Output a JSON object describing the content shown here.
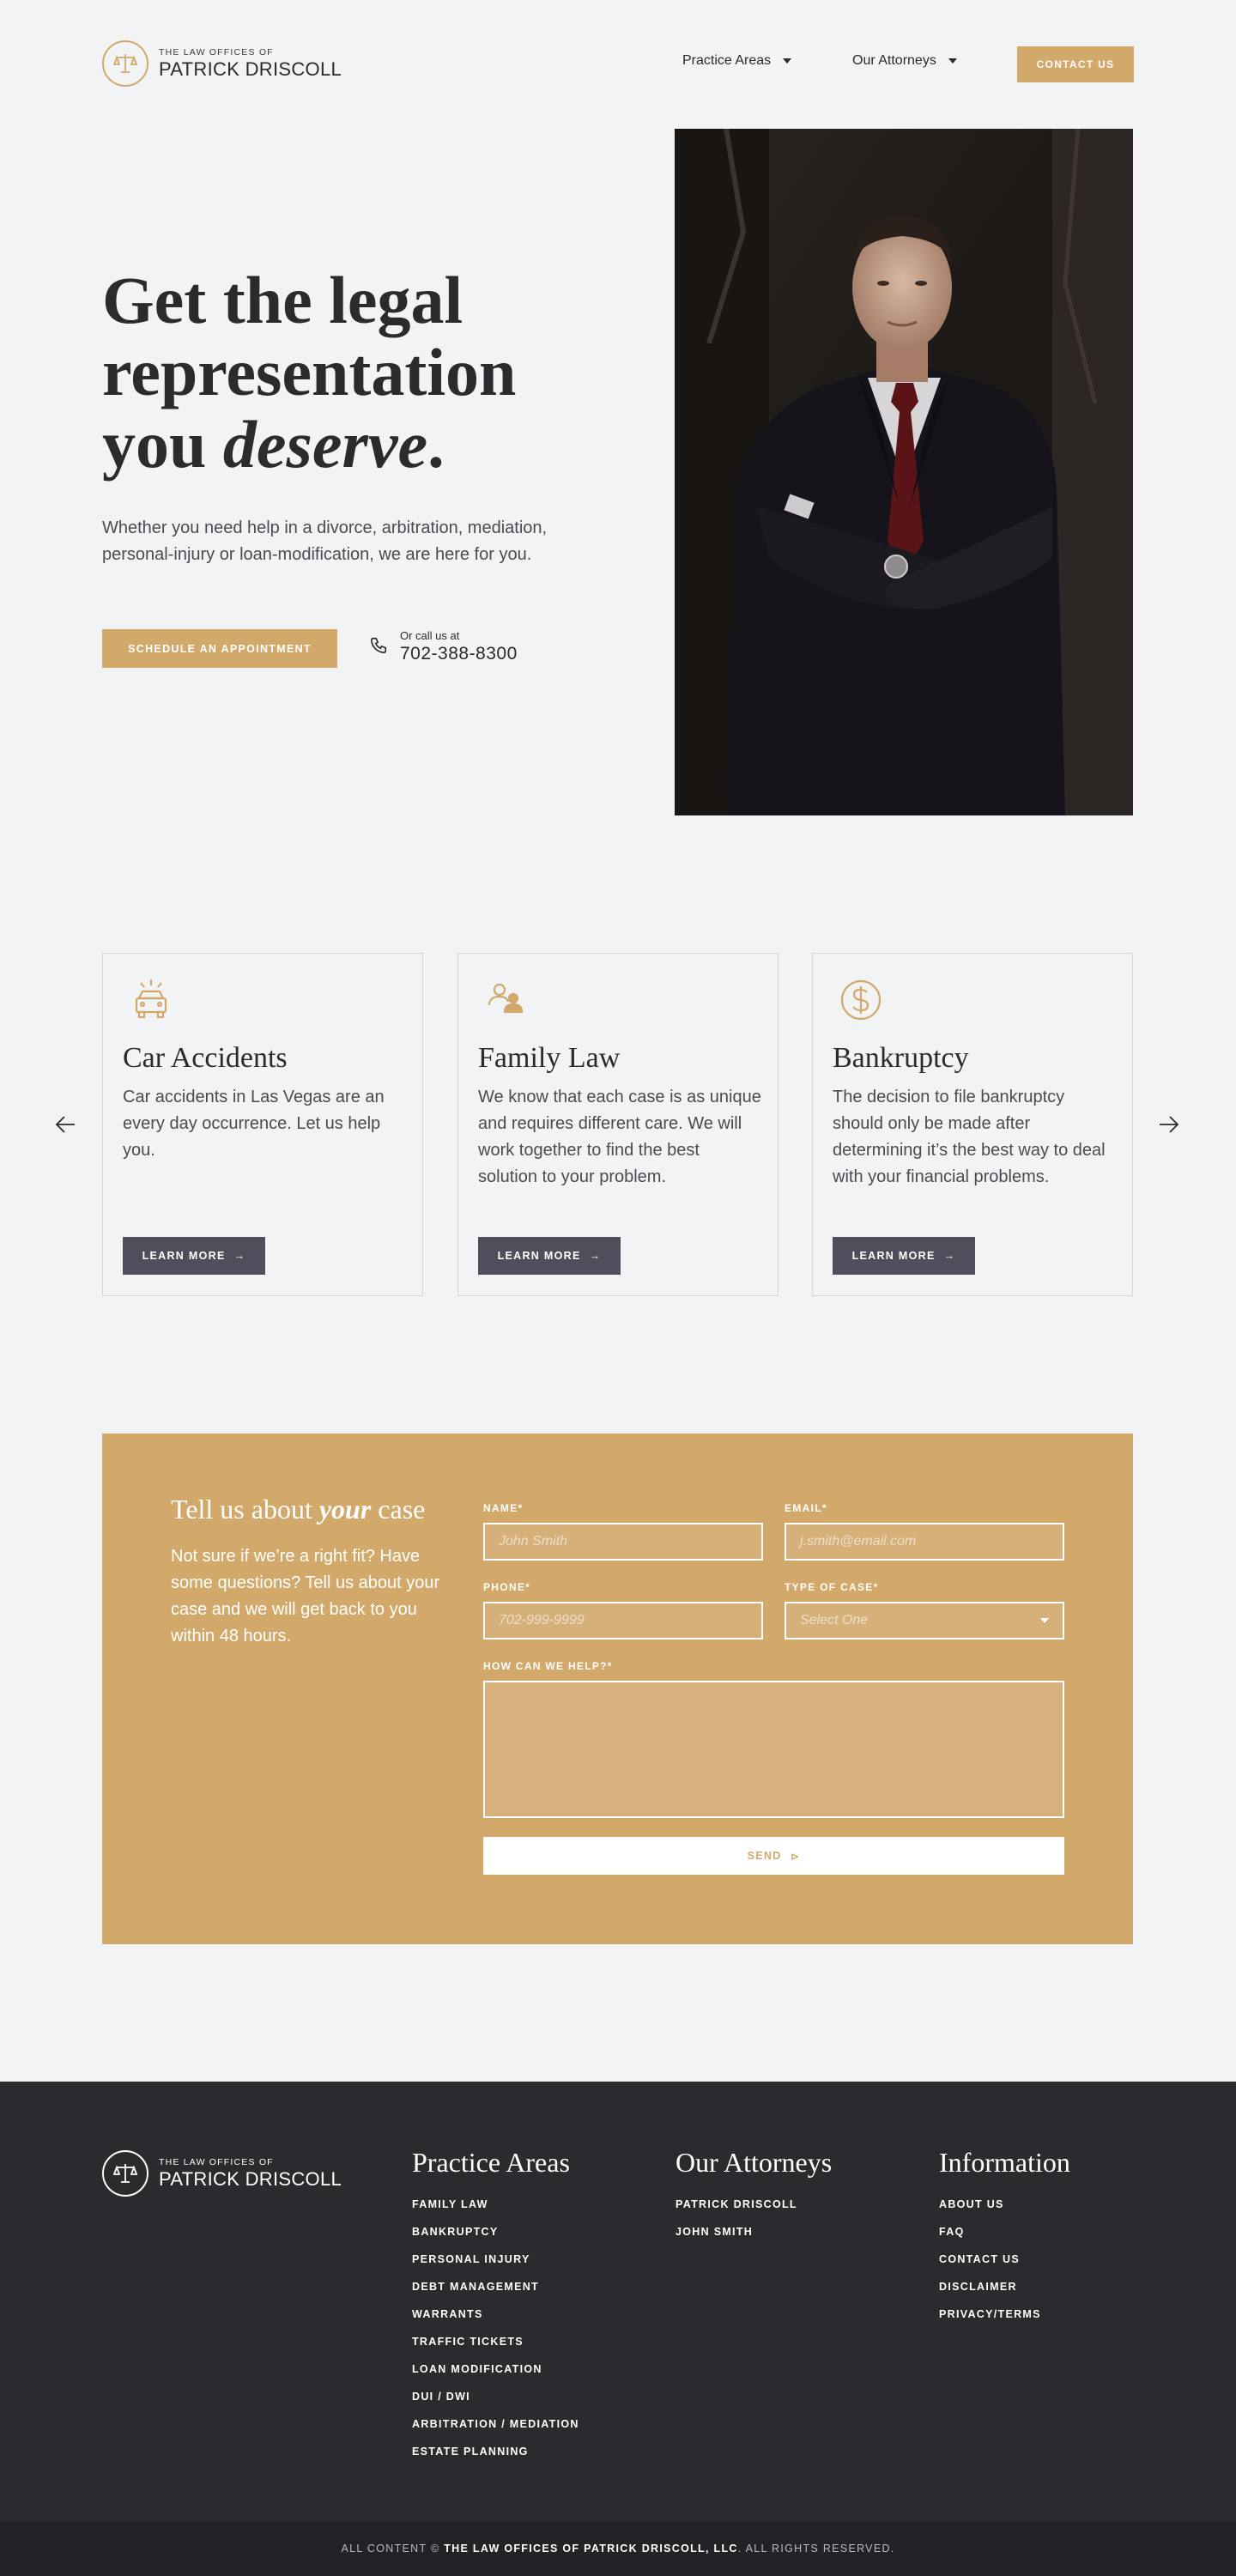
{
  "brand": {
    "small": "THE LAW OFFICES OF",
    "name": "PATRICK DRISCOLL"
  },
  "nav": {
    "practice": "Practice Areas",
    "attorneys": "Our Attorneys",
    "contact": "CONTACT US"
  },
  "hero": {
    "title_line1": "Get the legal",
    "title_line2": "representation",
    "title_line3_a": "you ",
    "title_line3_b": "deserve",
    "title_line3_c": ".",
    "lede": "Whether you need help in a divorce, arbitration, mediation, personal-injury or loan-modification, we are here for you.",
    "appointment": "SCHEDULE AN APPOINTMENT",
    "call_label": "Or call us at",
    "phone": "702-388-8300"
  },
  "cards": [
    {
      "title": "Car Accidents",
      "body": "Car accidents in Las Vegas are an every day occurrence. Let us help you.",
      "button": "LEARN MORE"
    },
    {
      "title": "Family Law",
      "body": "We know that each case is as unique and requires different care. We will work together to find the best solution to your problem.",
      "button": "LEARN MORE"
    },
    {
      "title": "Bankruptcy",
      "body": "The decision to file bankruptcy should only be made after determining it’s the best way to deal with your financial problems.",
      "button": "LEARN MORE"
    }
  ],
  "form": {
    "title_a": "Tell us about ",
    "title_b": "your",
    "title_c": " case",
    "lede": "Not sure if we’re a right fit? Have some questions? Tell us about your case and we will get back to you within 48 hours.",
    "name_label": "NAME*",
    "name_placeholder": "John Smith",
    "email_label": "EMAIL*",
    "email_placeholder": "j.smith@email.com",
    "phone_label": "PHONE*",
    "phone_placeholder": "702-999-9999",
    "type_label": "TYPE OF CASE*",
    "type_value": "Select One",
    "help_label": "HOW CAN WE HELP?*",
    "send": "SEND"
  },
  "footer": {
    "practice_title": "Practice Areas",
    "practice_links": [
      "FAMILY LAW",
      "BANKRUPTCY",
      "PERSONAL INJURY",
      "DEBT MANAGEMENT",
      "WARRANTS",
      "TRAFFIC TICKETS",
      "LOAN MODIFICATION",
      "DUI / DWI",
      "ARBITRATION / MEDIATION",
      "ESTATE PLANNING"
    ],
    "attorneys_title": "Our Attorneys",
    "attorneys_links": [
      "PATRICK DRISCOLL",
      "JOHN SMITH"
    ],
    "info_title": "Information",
    "info_links": [
      "ABOUT US",
      "FAQ",
      "CONTACT US",
      "DISCLAIMER",
      "PRIVACY/TERMS"
    ],
    "copyright_a": "ALL CONTENT © ",
    "copyright_b": "THE LAW OFFICES OF PATRICK DRISCOLL, LLC",
    "copyright_c": ". ALL RIGHTS RESERVED."
  },
  "colors": {
    "gold": "#d2a96b",
    "dark": "#2a2a2f",
    "slate": "#4f4e5c",
    "bg": "#f2f3f5"
  },
  "icons": [
    "scales-icon",
    "caret-down-icon",
    "phone-icon",
    "car-icon",
    "family-icon",
    "dollar-icon",
    "arrow-left-icon",
    "arrow-right-icon",
    "send-icon"
  ]
}
